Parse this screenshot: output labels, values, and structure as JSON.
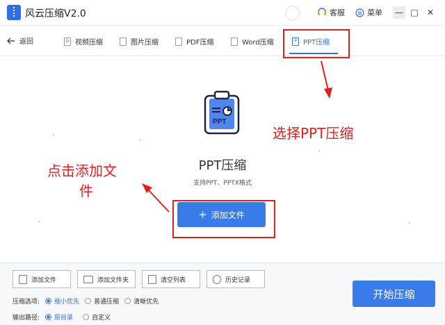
{
  "app": {
    "title": "风云压缩V2.0"
  },
  "header": {
    "service_label": "客服",
    "menu_label": "菜单",
    "min_label": "—",
    "max_label": "□",
    "close_label": "✕"
  },
  "tabs": {
    "back_label": "返回",
    "items": [
      {
        "label": "视频压缩",
        "icon": "video-file-icon",
        "glyph": "D"
      },
      {
        "label": "图片压缩",
        "icon": "image-file-icon",
        "glyph": ""
      },
      {
        "label": "PDF压缩",
        "icon": "pdf-file-icon",
        "glyph": ""
      },
      {
        "label": "Word压缩",
        "icon": "word-file-icon",
        "glyph": ""
      },
      {
        "label": "PPT压缩",
        "icon": "ppt-file-icon",
        "glyph": "P",
        "active": true
      }
    ]
  },
  "main": {
    "icon_text": "PPT",
    "title": "PPT压缩",
    "subtitle": "支持PPT、PPTX格式",
    "add_file_label": "添加文件",
    "add_icon": "+"
  },
  "annotations": {
    "select_ppt": "选择PPT压缩",
    "click_add_line1": "点击添加文",
    "click_add_line2": "件"
  },
  "toolbar": {
    "add_file": "添加文件",
    "add_folder": "添加文件夹",
    "clear_list": "清空列表",
    "history": "历史记录"
  },
  "options": {
    "compress_label": "压缩选项:",
    "compress_opts": [
      "缩小优先",
      "普通压缩",
      "清晰优先"
    ],
    "output_label": "输出路径:",
    "output_opts": [
      "原目录",
      "自定义"
    ]
  },
  "start_label": "开始压缩",
  "colors": {
    "accent": "#2f6ee6",
    "button": "#3a7bea",
    "annotation": "#e02020"
  }
}
